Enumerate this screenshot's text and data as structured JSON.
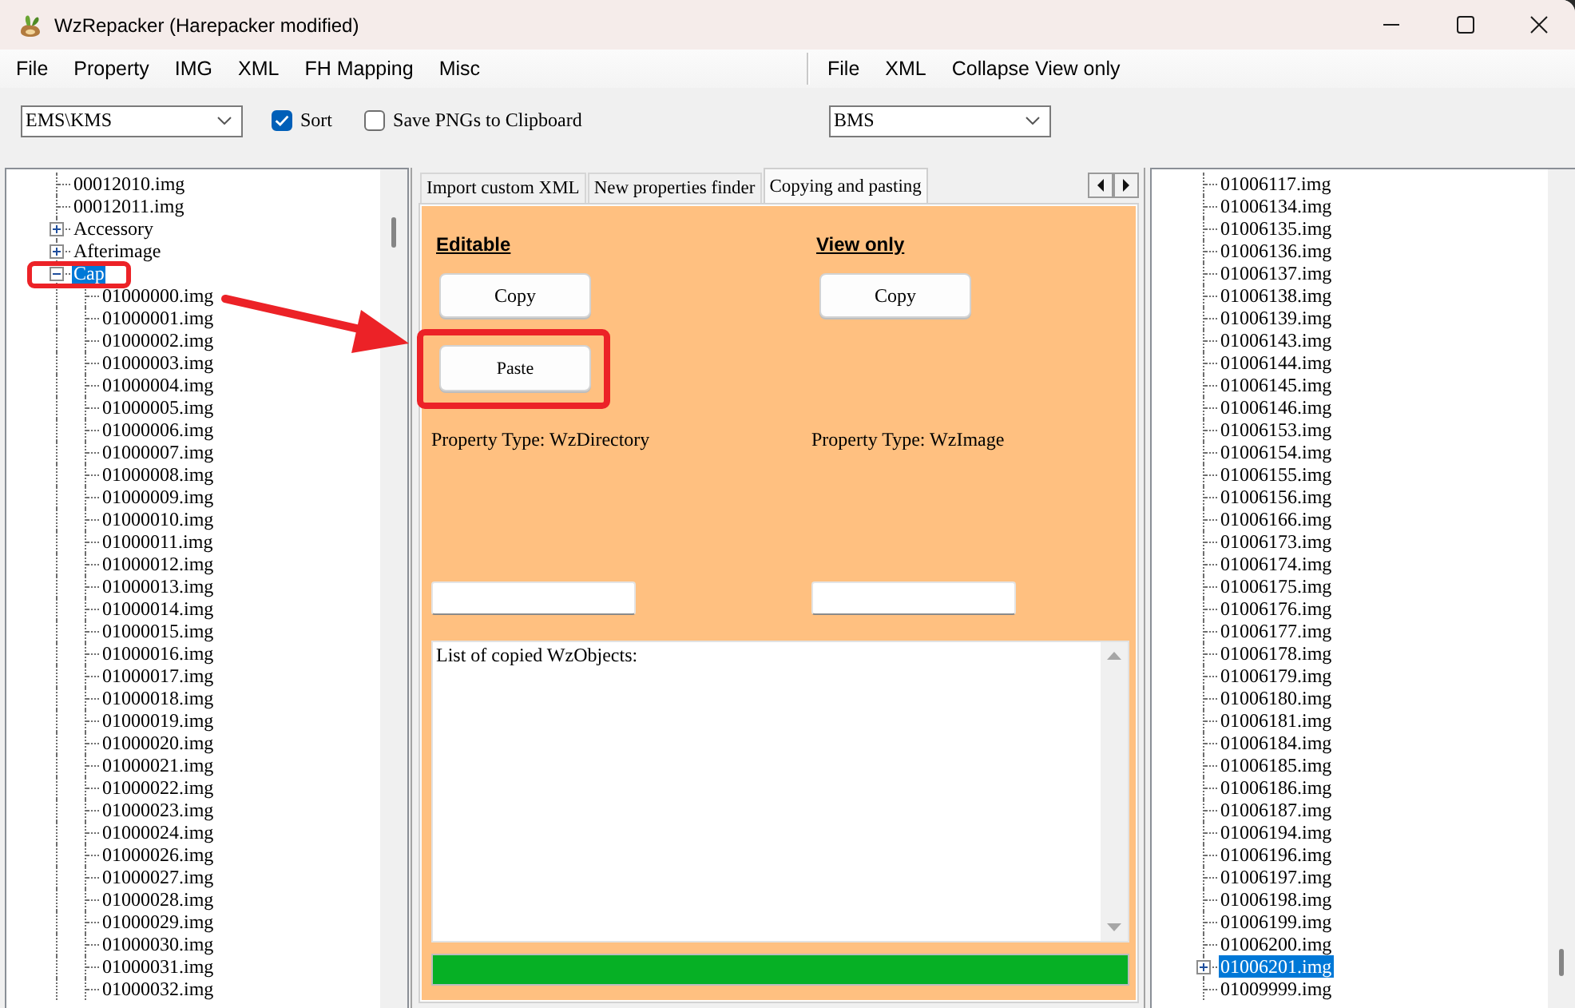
{
  "window": {
    "title": "WzRepacker (Harepacker modified)"
  },
  "left_pane": {
    "menu": [
      "File",
      "Property",
      "IMG",
      "XML",
      "FH Mapping",
      "Misc"
    ],
    "version_select": {
      "value": "EMS\\KMS"
    },
    "options": [
      {
        "label": "Sort",
        "checked": true
      },
      {
        "label": "Save PNGs to Clipboard",
        "checked": false
      }
    ]
  },
  "right_pane": {
    "menu": [
      "File",
      "XML",
      "Collapse View only"
    ],
    "version_select": {
      "value": "BMS"
    }
  },
  "left_tree": {
    "items": [
      {
        "label": "00012010.img",
        "kind": "leaf",
        "expanded": false,
        "selected": false
      },
      {
        "label": "00012011.img",
        "kind": "leaf",
        "expanded": false,
        "selected": false
      },
      {
        "label": "Accessory",
        "kind": "branch",
        "expanded": false,
        "selected": false
      },
      {
        "label": "Afterimage",
        "kind": "branch",
        "expanded": false,
        "selected": false
      },
      {
        "label": "Cap",
        "kind": "branch",
        "expanded": true,
        "selected": true,
        "children": [
          {
            "label": "01000000.img",
            "kind": "leaf",
            "expanded": false,
            "selected": false
          },
          {
            "label": "01000001.img",
            "kind": "leaf",
            "expanded": false,
            "selected": false
          },
          {
            "label": "01000002.img",
            "kind": "leaf",
            "expanded": false,
            "selected": false
          },
          {
            "label": "01000003.img",
            "kind": "leaf",
            "expanded": false,
            "selected": false
          },
          {
            "label": "01000004.img",
            "kind": "leaf",
            "expanded": false,
            "selected": false
          },
          {
            "label": "01000005.img",
            "kind": "leaf",
            "expanded": false,
            "selected": false
          },
          {
            "label": "01000006.img",
            "kind": "leaf",
            "expanded": false,
            "selected": false
          },
          {
            "label": "01000007.img",
            "kind": "leaf",
            "expanded": false,
            "selected": false
          },
          {
            "label": "01000008.img",
            "kind": "leaf",
            "expanded": false,
            "selected": false
          },
          {
            "label": "01000009.img",
            "kind": "leaf",
            "expanded": false,
            "selected": false
          },
          {
            "label": "01000010.img",
            "kind": "leaf",
            "expanded": false,
            "selected": false
          },
          {
            "label": "01000011.img",
            "kind": "leaf",
            "expanded": false,
            "selected": false
          },
          {
            "label": "01000012.img",
            "kind": "leaf",
            "expanded": false,
            "selected": false
          },
          {
            "label": "01000013.img",
            "kind": "leaf",
            "expanded": false,
            "selected": false
          },
          {
            "label": "01000014.img",
            "kind": "leaf",
            "expanded": false,
            "selected": false
          },
          {
            "label": "01000015.img",
            "kind": "leaf",
            "expanded": false,
            "selected": false
          },
          {
            "label": "01000016.img",
            "kind": "leaf",
            "expanded": false,
            "selected": false
          },
          {
            "label": "01000017.img",
            "kind": "leaf",
            "expanded": false,
            "selected": false
          },
          {
            "label": "01000018.img",
            "kind": "leaf",
            "expanded": false,
            "selected": false
          },
          {
            "label": "01000019.img",
            "kind": "leaf",
            "expanded": false,
            "selected": false
          },
          {
            "label": "01000020.img",
            "kind": "leaf",
            "expanded": false,
            "selected": false
          },
          {
            "label": "01000021.img",
            "kind": "leaf",
            "expanded": false,
            "selected": false
          },
          {
            "label": "01000022.img",
            "kind": "leaf",
            "expanded": false,
            "selected": false
          },
          {
            "label": "01000023.img",
            "kind": "leaf",
            "expanded": false,
            "selected": false
          },
          {
            "label": "01000024.img",
            "kind": "leaf",
            "expanded": false,
            "selected": false
          },
          {
            "label": "01000026.img",
            "kind": "leaf",
            "expanded": false,
            "selected": false
          },
          {
            "label": "01000027.img",
            "kind": "leaf",
            "expanded": false,
            "selected": false
          },
          {
            "label": "01000028.img",
            "kind": "leaf",
            "expanded": false,
            "selected": false
          },
          {
            "label": "01000029.img",
            "kind": "leaf",
            "expanded": false,
            "selected": false
          },
          {
            "label": "01000030.img",
            "kind": "leaf",
            "expanded": false,
            "selected": false
          },
          {
            "label": "01000031.img",
            "kind": "leaf",
            "expanded": false,
            "selected": false
          },
          {
            "label": "01000032.img",
            "kind": "leaf",
            "expanded": false,
            "selected": false
          }
        ]
      }
    ]
  },
  "editor": {
    "tabs": [
      {
        "label": "Import custom XML",
        "selected": false
      },
      {
        "label": "New properties finder",
        "selected": false
      },
      {
        "label": "Copying and pasting",
        "selected": true
      }
    ],
    "sections": [
      {
        "heading": "Editable",
        "buttons": [
          {
            "kind": "copy",
            "label": "Copy"
          },
          {
            "kind": "paste",
            "label": "Paste"
          }
        ],
        "property_type": "Property Type: WzDirectory"
      },
      {
        "heading": "View only",
        "buttons": [
          {
            "kind": "copy",
            "label": "Copy"
          }
        ],
        "property_type": "Property Type: WzImage"
      }
    ],
    "copied_list": {
      "header": "List of copied WzObjects:"
    },
    "progress": {
      "level": 1
    }
  },
  "right_tree": {
    "items": [
      {
        "label": "01006117.img",
        "kind": "leaf",
        "expanded": false,
        "selected": false
      },
      {
        "label": "01006134.img",
        "kind": "leaf",
        "expanded": false,
        "selected": false
      },
      {
        "label": "01006135.img",
        "kind": "leaf",
        "expanded": false,
        "selected": false
      },
      {
        "label": "01006136.img",
        "kind": "leaf",
        "expanded": false,
        "selected": false
      },
      {
        "label": "01006137.img",
        "kind": "leaf",
        "expanded": false,
        "selected": false
      },
      {
        "label": "01006138.img",
        "kind": "leaf",
        "expanded": false,
        "selected": false
      },
      {
        "label": "01006139.img",
        "kind": "leaf",
        "expanded": false,
        "selected": false
      },
      {
        "label": "01006143.img",
        "kind": "leaf",
        "expanded": false,
        "selected": false
      },
      {
        "label": "01006144.img",
        "kind": "leaf",
        "expanded": false,
        "selected": false
      },
      {
        "label": "01006145.img",
        "kind": "leaf",
        "expanded": false,
        "selected": false
      },
      {
        "label": "01006146.img",
        "kind": "leaf",
        "expanded": false,
        "selected": false
      },
      {
        "label": "01006153.img",
        "kind": "leaf",
        "expanded": false,
        "selected": false
      },
      {
        "label": "01006154.img",
        "kind": "leaf",
        "expanded": false,
        "selected": false
      },
      {
        "label": "01006155.img",
        "kind": "leaf",
        "expanded": false,
        "selected": false
      },
      {
        "label": "01006156.img",
        "kind": "leaf",
        "expanded": false,
        "selected": false
      },
      {
        "label": "01006166.img",
        "kind": "leaf",
        "expanded": false,
        "selected": false
      },
      {
        "label": "01006173.img",
        "kind": "leaf",
        "expanded": false,
        "selected": false
      },
      {
        "label": "01006174.img",
        "kind": "leaf",
        "expanded": false,
        "selected": false
      },
      {
        "label": "01006175.img",
        "kind": "leaf",
        "expanded": false,
        "selected": false
      },
      {
        "label": "01006176.img",
        "kind": "leaf",
        "expanded": false,
        "selected": false
      },
      {
        "label": "01006177.img",
        "kind": "leaf",
        "expanded": false,
        "selected": false
      },
      {
        "label": "01006178.img",
        "kind": "leaf",
        "expanded": false,
        "selected": false
      },
      {
        "label": "01006179.img",
        "kind": "leaf",
        "expanded": false,
        "selected": false
      },
      {
        "label": "01006180.img",
        "kind": "leaf",
        "expanded": false,
        "selected": false
      },
      {
        "label": "01006181.img",
        "kind": "leaf",
        "expanded": false,
        "selected": false
      },
      {
        "label": "01006184.img",
        "kind": "leaf",
        "expanded": false,
        "selected": false
      },
      {
        "label": "01006185.img",
        "kind": "leaf",
        "expanded": false,
        "selected": false
      },
      {
        "label": "01006186.img",
        "kind": "leaf",
        "expanded": false,
        "selected": false
      },
      {
        "label": "01006187.img",
        "kind": "leaf",
        "expanded": false,
        "selected": false
      },
      {
        "label": "01006194.img",
        "kind": "leaf",
        "expanded": false,
        "selected": false
      },
      {
        "label": "01006196.img",
        "kind": "leaf",
        "expanded": false,
        "selected": false
      },
      {
        "label": "01006197.img",
        "kind": "leaf",
        "expanded": false,
        "selected": false
      },
      {
        "label": "01006198.img",
        "kind": "leaf",
        "expanded": false,
        "selected": false
      },
      {
        "label": "01006199.img",
        "kind": "leaf",
        "expanded": false,
        "selected": false
      },
      {
        "label": "01006200.img",
        "kind": "leaf",
        "expanded": false,
        "selected": false
      },
      {
        "label": "01006201.img",
        "kind": "branch",
        "expanded": false,
        "selected": true
      },
      {
        "label": "01009999.img",
        "kind": "leaf",
        "expanded": false,
        "selected": false
      }
    ]
  }
}
